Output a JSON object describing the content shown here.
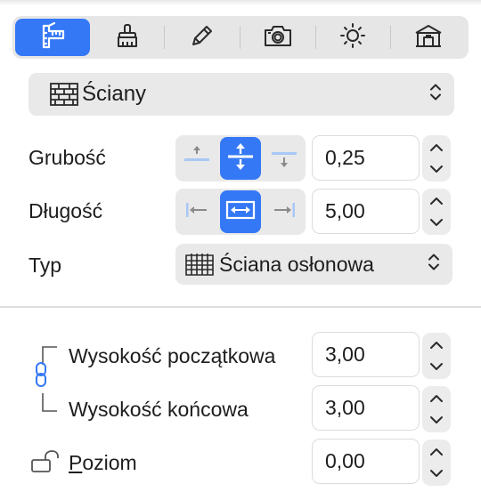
{
  "toolbar": {
    "tabs": [
      {
        "name": "dimensions",
        "icon": "dimensions-icon",
        "active": true
      },
      {
        "name": "paint",
        "icon": "paint-brush-icon",
        "active": false
      },
      {
        "name": "edit",
        "icon": "pencil-icon",
        "active": false
      },
      {
        "name": "camera",
        "icon": "camera-icon",
        "active": false
      },
      {
        "name": "light",
        "icon": "sun-icon",
        "active": false
      },
      {
        "name": "building",
        "icon": "building-icon",
        "active": false
      }
    ]
  },
  "category": {
    "label": "Ściany"
  },
  "fields": {
    "thickness": {
      "label": "Grubość",
      "value": "0,25"
    },
    "length": {
      "label": "Długość",
      "value": "5,00"
    },
    "type": {
      "label": "Typ",
      "selected": "Ściana osłonowa"
    },
    "start_height": {
      "label": "Wysokość początkowa",
      "value": "3,00"
    },
    "end_height": {
      "label": "Wysokość końcowa",
      "value": "3,00"
    },
    "level": {
      "label_prefix": "P",
      "label_rest": "oziom",
      "value": "0,00"
    }
  },
  "colors": {
    "accent": "#3478f6",
    "control_bg": "#e9e9e9"
  }
}
